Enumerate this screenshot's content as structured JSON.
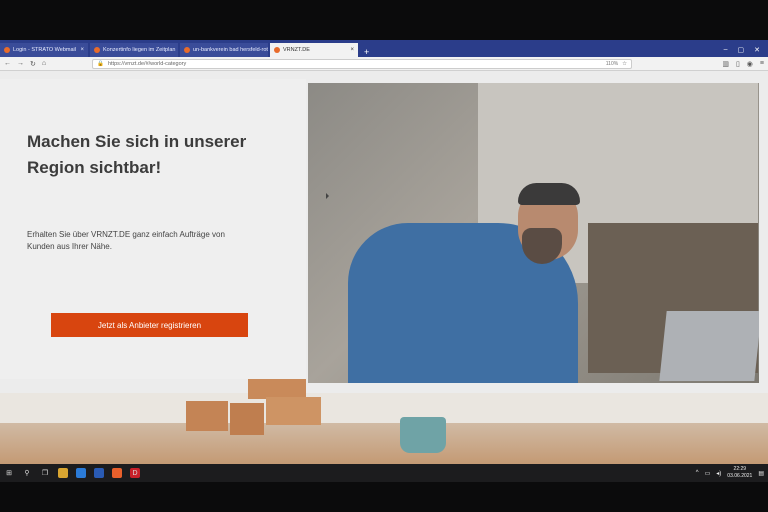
{
  "browser": {
    "tabs": [
      {
        "label": "Login - STRATO Webmail",
        "active": false
      },
      {
        "label": "Konzertinfo liegen im Zeitplan",
        "active": false
      },
      {
        "label": "un-bankverein bad hersfeld-rot",
        "active": false
      },
      {
        "label": "VRNZT.DE",
        "active": true
      }
    ],
    "new_tab": "+",
    "url": "https://vrnzt.de/#/world-category",
    "zoom": "110%"
  },
  "hero": {
    "headline": "Machen Sie sich in unserer Region sichtbar!",
    "subtext": "Erhalten Sie über VRNZT.DE ganz einfach Aufträge von Kunden aus Ihrer Nähe.",
    "cta_label": "Jetzt als Anbieter registrieren"
  },
  "taskbar": {
    "time": "22:29",
    "date": "03.06.2021"
  },
  "colors": {
    "cta": "#d8450f",
    "tabbar": "#2b3d8a"
  }
}
